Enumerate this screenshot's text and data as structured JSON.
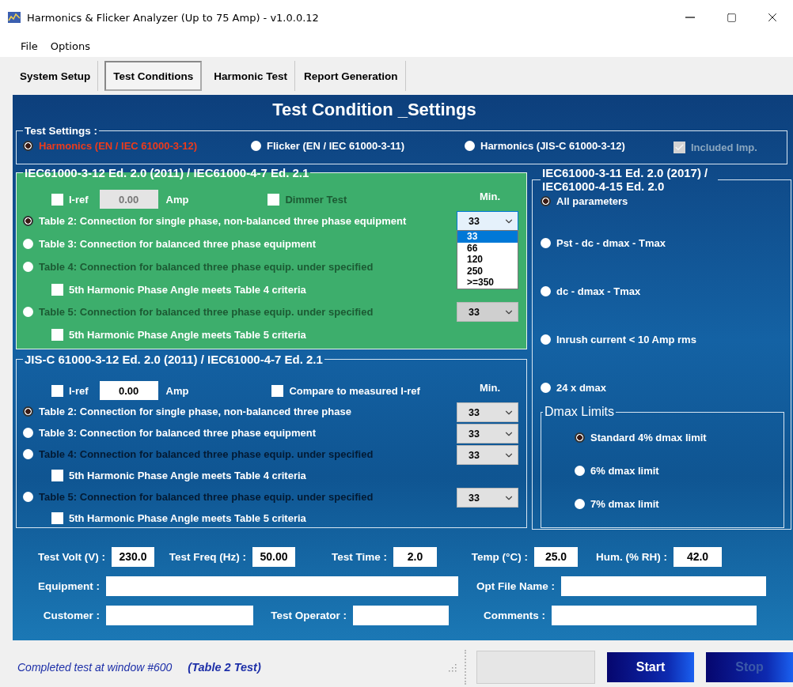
{
  "window": {
    "title": "Harmonics & Flicker Analyzer (Up to 75 Amp) - v1.0.0.12"
  },
  "menu": [
    "File",
    "Options"
  ],
  "tabs": [
    {
      "label": "System Setup",
      "selected": false
    },
    {
      "label": "Test Conditions",
      "selected": true
    },
    {
      "label": "Harmonic Test",
      "selected": false
    },
    {
      "label": "Report Generation",
      "selected": false
    }
  ],
  "heading": "Test Condition _Settings",
  "test_settings": {
    "legend": "Test Settings :",
    "options": [
      {
        "label": "Harmonics (EN / IEC 61000-3-12)",
        "selected": true
      },
      {
        "label": "Flicker (EN / IEC 61000-3-11)",
        "selected": false
      },
      {
        "label": "Harmonics (JIS-C 61000-3-12)",
        "selected": false
      }
    ],
    "included_imp": {
      "label": "Included Imp.",
      "checked": true,
      "disabled": true
    }
  },
  "iec_harmonics": {
    "legend": "IEC61000-3-12 Ed. 2.0 (2011) / IEC61000-4-7 Ed. 2.1",
    "iref": {
      "label": "I-ref",
      "checked": false,
      "value": "0.00",
      "unit": "Amp",
      "disabled": true
    },
    "extra_check": {
      "label": "Dimmer Test",
      "checked": false,
      "disabled": true
    },
    "min_label": "Min.",
    "tables": [
      {
        "label": "Table 2: Connection for single phase, non-balanced three phase equipment",
        "selected": true,
        "disabled": false,
        "dropdown": {
          "value": "33",
          "disabled": false,
          "open": true
        }
      },
      {
        "label": "Table 3: Connection for balanced three phase equipment",
        "selected": false,
        "disabled": false
      },
      {
        "label": "Table 4: Connection for balanced three phase equip. under specified",
        "selected": false,
        "disabled": true,
        "sub_check": {
          "label": "5th Harmonic Phase Angle meets Table 4 criteria",
          "checked": false
        }
      },
      {
        "label": "Table 5: Connection for balanced three phase equip. under specified",
        "selected": false,
        "disabled": true,
        "dropdown": {
          "value": "33",
          "disabled": true,
          "open": false
        },
        "sub_check": {
          "label": "5th Harmonic Phase Angle meets Table 5 criteria",
          "checked": false
        }
      }
    ],
    "dropdown_options": [
      {
        "label": "33",
        "selected": true
      },
      {
        "label": "66",
        "selected": false
      },
      {
        "label": "120",
        "selected": false
      },
      {
        "label": "250",
        "selected": false
      },
      {
        "label": ">=350",
        "selected": false
      }
    ]
  },
  "jis_harmonics": {
    "legend": "JIS-C 61000-3-12 Ed. 2.0 (2011) / IEC61000-4-7 Ed. 2.1",
    "iref": {
      "label": "I-ref",
      "checked": false,
      "value": "0.00",
      "unit": "Amp",
      "disabled": false
    },
    "extra_check": {
      "label": "Compare to measured I-ref",
      "checked": false,
      "disabled": false
    },
    "min_label": "Min.",
    "tables": [
      {
        "label": "Table 2: Connection for single phase, non-balanced three phase",
        "selected": true,
        "disabled": false,
        "dropdown": {
          "value": "33",
          "disabled": false,
          "open": false
        }
      },
      {
        "label": "Table 3: Connection for balanced three phase equipment",
        "selected": false,
        "disabled": false,
        "dropdown": {
          "value": "33",
          "disabled": false,
          "open": false
        }
      },
      {
        "label": "Table 4: Connection for balanced three phase equip. under specified",
        "selected": false,
        "disabled": true,
        "dropdown": {
          "value": "33",
          "disabled": false,
          "open": false
        },
        "sub_check": {
          "label": "5th Harmonic Phase Angle meets Table 4 criteria",
          "checked": false
        }
      },
      {
        "label": "Table 5: Connection for balanced three phase equip. under specified",
        "selected": false,
        "disabled": true,
        "dropdown": {
          "value": "33",
          "disabled": false,
          "open": false
        },
        "sub_check": {
          "label": "5th Harmonic Phase Angle meets Table 5 criteria",
          "checked": false
        }
      }
    ]
  },
  "flicker": {
    "legend": "IEC61000-3-11 Ed. 2.0 (2017) / IEC61000-4-15 Ed. 2.0",
    "options": [
      {
        "label": "All parameters",
        "selected": true
      },
      {
        "label": "Pst - dc - dmax - Tmax",
        "selected": false
      },
      {
        "label": "dc - dmax - Tmax",
        "selected": false
      },
      {
        "label": "Inrush current < 10 Amp rms",
        "selected": false
      },
      {
        "label": "24 x dmax",
        "selected": false
      }
    ],
    "dmax_limits": {
      "legend": "Dmax Limits",
      "options": [
        {
          "label": "Standard 4% dmax limit",
          "selected": true
        },
        {
          "label": "6% dmax limit",
          "selected": false
        },
        {
          "label": "7% dmax limit",
          "selected": false
        }
      ]
    }
  },
  "fields": [
    [
      {
        "label": "Test Volt (V) :",
        "value": "230.0"
      },
      {
        "label": "Test Freq (Hz) :",
        "value": "50.00"
      },
      {
        "label": "Test Time :",
        "value": "2.0"
      },
      {
        "label": "Temp (°C) :",
        "value": "25.0"
      },
      {
        "label": "Hum. (% RH) :",
        "value": "42.0"
      }
    ],
    [
      {
        "label": "Equipment :"
      },
      {
        "label": "Opt File Name :"
      }
    ],
    [
      {
        "label": "Customer :"
      },
      {
        "label": "Test Operator :"
      },
      {
        "label": "Comments :"
      }
    ]
  ],
  "status_bar": {
    "message": "Completed test at window #600",
    "test": "(Table 2 Test)"
  },
  "buttons": [
    {
      "label": "Start",
      "disabled": false
    },
    {
      "label": "Stop",
      "disabled": true
    }
  ]
}
